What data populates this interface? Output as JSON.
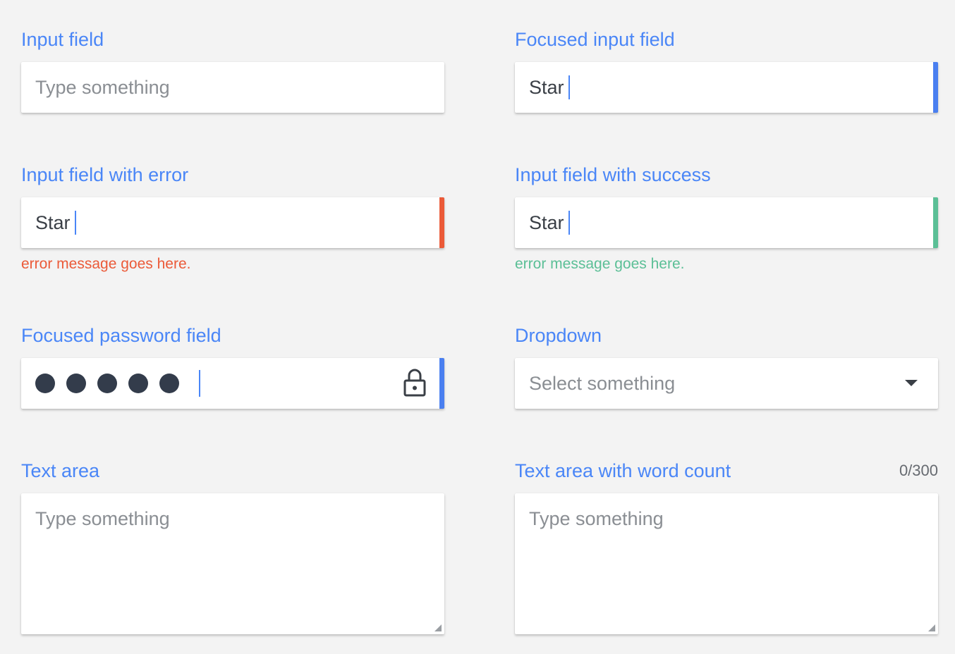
{
  "colors": {
    "label": "#4a86f7",
    "focus_accent": "#4a7ff0",
    "error": "#eb5a38",
    "success": "#5bbf96",
    "background": "#f3f3f3"
  },
  "input_field": {
    "label": "Input field",
    "placeholder": "Type something"
  },
  "focused_input_field": {
    "label": "Focused input field",
    "value": "Star"
  },
  "error_field": {
    "label": "Input field with error",
    "value": "Star",
    "message": "error message goes here."
  },
  "success_field": {
    "label": "Input field with success",
    "value": "Star",
    "message": "error message goes here."
  },
  "password_field": {
    "label": "Focused password field",
    "masked_char_count": 5,
    "icon": "lock-icon"
  },
  "dropdown": {
    "label": "Dropdown",
    "placeholder": "Select something",
    "icon": "caret-down-icon"
  },
  "text_area": {
    "label": "Text area",
    "placeholder": "Type something"
  },
  "text_area_word_count": {
    "label": "Text area with word count",
    "counter": "0/300",
    "placeholder": "Type something"
  }
}
